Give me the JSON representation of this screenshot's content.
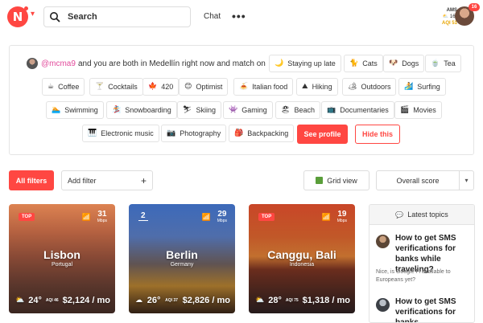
{
  "header": {
    "search_label": "Search",
    "chat_label": "Chat",
    "more_label": "•••",
    "weather_city": "AMS",
    "weather_temp": "16°",
    "weather_aqi": "AQI 51",
    "notification_count": "16",
    "brand_color": "#ff4742"
  },
  "match": {
    "username": "@mcma9",
    "sentence": "and you are both in Medellín right now and match on",
    "tags": [
      {
        "label": "Staying up late",
        "icon": "🌙"
      },
      {
        "label": "Cats",
        "icon": "🐈"
      },
      {
        "label": "Dogs",
        "icon": "🐶"
      },
      {
        "label": "Tea",
        "icon": "🍵"
      },
      {
        "label": "Coffee",
        "icon": "☕"
      },
      {
        "label": "Cocktails",
        "icon": "🍸"
      },
      {
        "label": "420",
        "icon": "🍁"
      },
      {
        "label": "Optimist",
        "icon": "😊"
      },
      {
        "label": "Italian food",
        "icon": "🍝"
      },
      {
        "label": "Hiking",
        "icon": "⛰"
      },
      {
        "label": "Outdoors",
        "icon": "🏕"
      },
      {
        "label": "Surfing",
        "icon": "🏄"
      },
      {
        "label": "Swimming",
        "icon": "🏊"
      },
      {
        "label": "Snowboarding",
        "icon": "🏂"
      },
      {
        "label": "Skiing",
        "icon": "⛷"
      },
      {
        "label": "Gaming",
        "icon": "👾"
      },
      {
        "label": "Beach",
        "icon": "🏖"
      },
      {
        "label": "Documentaries",
        "icon": "📺"
      },
      {
        "label": "Movies",
        "icon": "🎬"
      },
      {
        "label": "Electronic music",
        "icon": "🎹"
      },
      {
        "label": "Photography",
        "icon": "📷"
      },
      {
        "label": "Backpacking",
        "icon": "🎒"
      }
    ],
    "see_profile_label": "See profile",
    "hide_label": "Hide this"
  },
  "filters": {
    "all_filters_label": "All filters",
    "add_filter_label": "Add filter",
    "add_icon": "+",
    "grid_view_label": "Grid view",
    "sort_label": "Overall score",
    "sort_caret": "▾"
  },
  "cities": [
    {
      "name": "Lisbon",
      "country": "Portugal",
      "badge": "TOP",
      "speed": "31",
      "speed_unit": "Mbps",
      "temp": "24°",
      "aqi": "AQI 46",
      "price": "$2,124 / mo",
      "weather_icon": "⛅"
    },
    {
      "name": "Berlin",
      "country": "Germany",
      "rank": "2",
      "speed": "29",
      "speed_unit": "Mbps",
      "temp": "26°",
      "aqi": "AQI 37",
      "price": "$2,826 / mo",
      "weather_icon": "☁"
    },
    {
      "name": "Canggu, Bali",
      "country": "Indonesia",
      "badge": "TOP",
      "speed": "19",
      "speed_unit": "Mbps",
      "temp": "28°",
      "aqi": "AQI 75",
      "price": "$1,318 / mo",
      "weather_icon": "⛅"
    }
  ],
  "sidebar": {
    "title": "Latest topics",
    "topics": [
      {
        "title": "How to get SMS verifications for banks while traveling?",
        "subtitle": "Nice, is Google Fi available to Europeans yet?"
      },
      {
        "title": "How to get SMS verifications for banks",
        "subtitle": ""
      }
    ]
  }
}
